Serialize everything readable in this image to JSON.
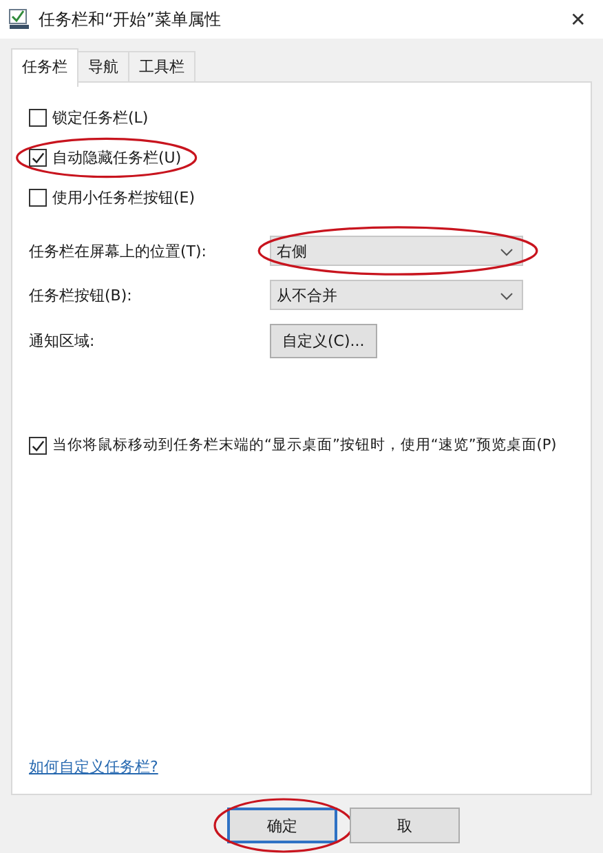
{
  "window": {
    "title": "任务栏和“开始”菜单属性",
    "close": "✕"
  },
  "tabs": [
    {
      "label": "任务栏",
      "selected": true
    },
    {
      "label": "导航",
      "selected": false
    },
    {
      "label": "工具栏",
      "selected": false
    }
  ],
  "options": [
    {
      "label": "锁定任务栏(L)",
      "checked": false,
      "circled": false
    },
    {
      "label": "自动隐藏任务栏(U)",
      "checked": true,
      "circled": true
    },
    {
      "label": "使用小任务栏按钮(E)",
      "checked": false,
      "circled": false
    }
  ],
  "settings": [
    {
      "kind": "dropdown",
      "label": "任务栏在屏幕上的位置(T):",
      "value": "右侧",
      "circled": true
    },
    {
      "kind": "dropdown",
      "label": "任务栏按钮(B):",
      "value": "从不合并",
      "circled": false
    },
    {
      "kind": "button",
      "label": "通知区域:",
      "value": "自定义(C)...",
      "circled": false
    }
  ],
  "peek": {
    "label": "当你将鼠标移动到任务栏末端的“显示桌面”按钮时，使用“速览”预览桌面(P)",
    "checked": true
  },
  "help_link": "如何自定义任务栏?",
  "buttons": [
    {
      "label": "确定",
      "default": true,
      "circled": true
    },
    {
      "label": "取",
      "default": false,
      "circled": false
    }
  ]
}
